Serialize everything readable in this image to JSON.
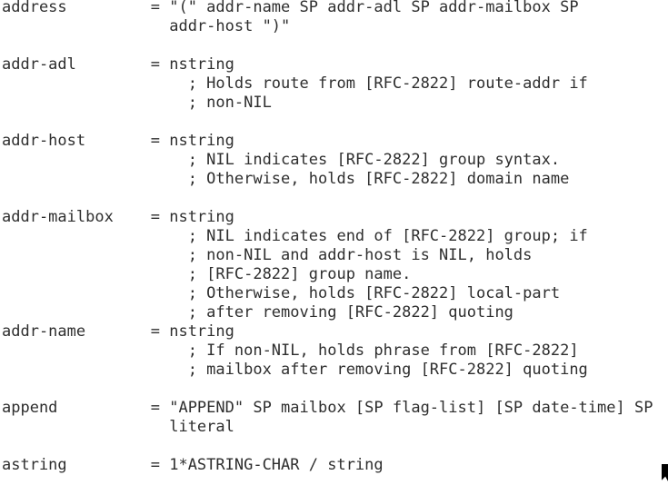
{
  "lines": [
    "address         = \"(\" addr-name SP addr-adl SP addr-mailbox SP",
    "                  addr-host \")\"",
    "",
    "addr-adl        = nstring",
    "                    ; Holds route from [RFC-2822] route-addr if",
    "                    ; non-NIL",
    "",
    "addr-host       = nstring",
    "                    ; NIL indicates [RFC-2822] group syntax.",
    "                    ; Otherwise, holds [RFC-2822] domain name",
    "",
    "addr-mailbox    = nstring",
    "                    ; NIL indicates end of [RFC-2822] group; if",
    "                    ; non-NIL and addr-host is NIL, holds",
    "                    ; [RFC-2822] group name.",
    "                    ; Otherwise, holds [RFC-2822] local-part",
    "                    ; after removing [RFC-2822] quoting",
    "addr-name       = nstring",
    "                    ; If non-NIL, holds phrase from [RFC-2822]",
    "                    ; mailbox after removing [RFC-2822] quoting",
    "",
    "append          = \"APPEND\" SP mailbox [SP flag-list] [SP date-time] SP",
    "                  literal",
    "",
    "astring         = 1*ASTRING-CHAR / string"
  ],
  "icons": {
    "cursor": "mouse-pointer-icon"
  },
  "colors": {
    "text": "#2e2e2e",
    "background": "#ffffff"
  }
}
